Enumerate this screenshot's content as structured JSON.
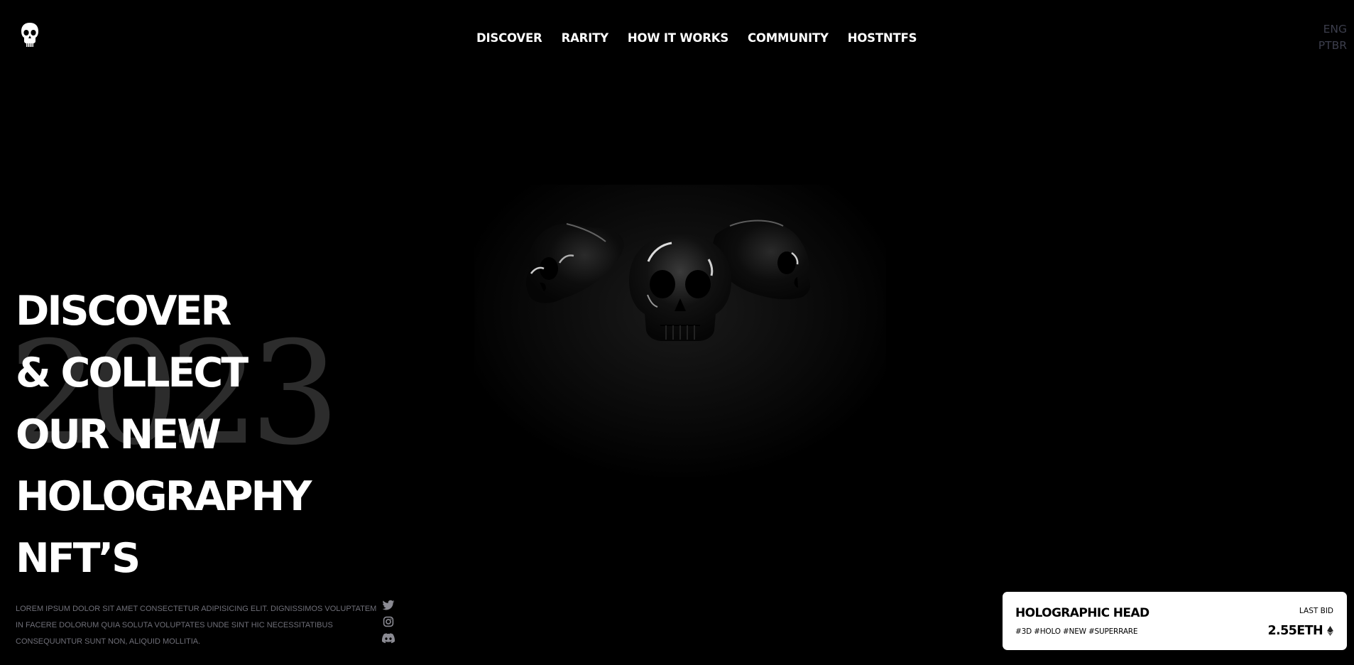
{
  "header": {
    "logo_icon": "skull-logo-icon",
    "nav": [
      {
        "label": "DISCOVER"
      },
      {
        "label": "RARITY"
      },
      {
        "label": "HOW IT WORKS"
      },
      {
        "label": "COMMUNITY"
      },
      {
        "label": "HOSTNTFS"
      }
    ],
    "languages": [
      {
        "label": "ENG"
      },
      {
        "label": "PTBR"
      }
    ]
  },
  "hero": {
    "image_icon": "three-chrome-skulls-image",
    "year": "2023",
    "headline": [
      "DISCOVER",
      "& COLLECT",
      "OUR NEW",
      "HOLOGRAPHY",
      "NFT’S"
    ],
    "description": "LOREM IPSUM DOLOR SIT AMET CONSECTETUR ADIPISICING ELIT. DIGNISSIMOS VOLUPTATEM IN FACERE DOLORUM QUIA SOLUTA VOLUPTATES UNDE SINT HIC NECESSITATIBUS CONSEQUUNTUR SUNT NON, ALIQUID MOLLITIA."
  },
  "social": [
    {
      "icon": "twitter-icon"
    },
    {
      "icon": "instagram-icon"
    },
    {
      "icon": "discord-icon"
    }
  ],
  "bid_card": {
    "name": "HOLOGRAPHIC HEAD",
    "tags": "#3D #HOLO #NEW #SUPERRARE",
    "last_bid_label": "LAST BID",
    "price": "2.55ETH",
    "currency_icon": "ethereum-icon"
  },
  "colors": {
    "background": "#000000",
    "text": "#ffffff",
    "muted_text": "#6f6f78",
    "language_text": "#3c3e4c",
    "year_watermark": "#2c2c2c",
    "card_background": "#ffffff"
  }
}
